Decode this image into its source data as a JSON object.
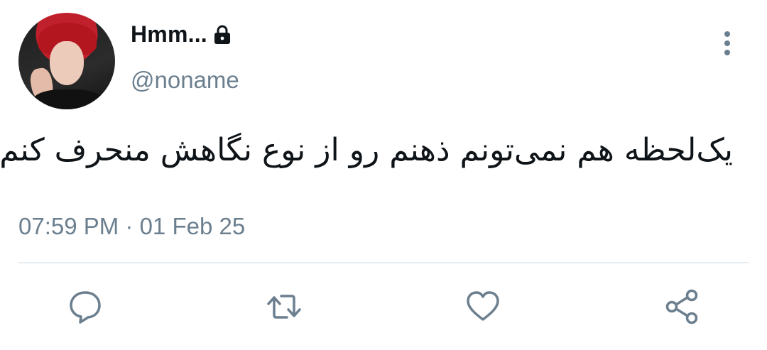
{
  "user": {
    "display_name": "Hmm...",
    "handle": "@noname",
    "locked_icon": "lock-icon",
    "avatar": "avatar-photo"
  },
  "tweet": {
    "text": "یک‌لحظه هم نمی‌تونم ذهنم رو از نوع نگاهش منحرف کنم.",
    "timestamp": "07:59 PM · 01 Feb 25"
  },
  "menu": {
    "icon": "more-vertical-icon"
  },
  "actions": [
    {
      "name": "reply",
      "icon": "reply-icon"
    },
    {
      "name": "retweet",
      "icon": "retweet-icon"
    },
    {
      "name": "like",
      "icon": "heart-icon"
    },
    {
      "name": "share",
      "icon": "share-icon"
    }
  ],
  "colors": {
    "text_primary": "#0f1419",
    "text_secondary": "#6b7f8f",
    "icon": "#6b7f8f",
    "divider": "#e6ecf0"
  }
}
